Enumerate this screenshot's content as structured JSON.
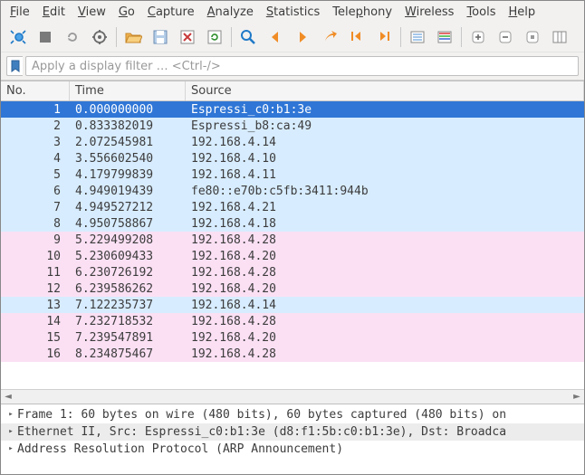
{
  "menu": {
    "items": [
      {
        "label": "File",
        "accel": 0
      },
      {
        "label": "Edit",
        "accel": 0
      },
      {
        "label": "View",
        "accel": 0
      },
      {
        "label": "Go",
        "accel": 0
      },
      {
        "label": "Capture",
        "accel": 0
      },
      {
        "label": "Analyze",
        "accel": 0
      },
      {
        "label": "Statistics",
        "accel": 0
      },
      {
        "label": "Telephony",
        "accel": 4
      },
      {
        "label": "Wireless",
        "accel": 0
      },
      {
        "label": "Tools",
        "accel": 0
      },
      {
        "label": "Help",
        "accel": 0
      }
    ]
  },
  "filter": {
    "placeholder": "Apply a display filter … <Ctrl-/>"
  },
  "columns": {
    "no": "No.",
    "time": "Time",
    "src": "Source"
  },
  "packets": [
    {
      "no": 1,
      "time": "0.000000000",
      "src": "Espressi_c0:b1:3e",
      "bg": "selected"
    },
    {
      "no": 2,
      "time": "0.833382019",
      "src": "Espressi_b8:ca:49",
      "bg": "blue"
    },
    {
      "no": 3,
      "time": "2.072545981",
      "src": "192.168.4.14",
      "bg": "blue"
    },
    {
      "no": 4,
      "time": "3.556602540",
      "src": "192.168.4.10",
      "bg": "blue"
    },
    {
      "no": 5,
      "time": "4.179799839",
      "src": "192.168.4.11",
      "bg": "blue"
    },
    {
      "no": 6,
      "time": "4.949019439",
      "src": "fe80::e70b:c5fb:3411:944b",
      "bg": "blue"
    },
    {
      "no": 7,
      "time": "4.949527212",
      "src": "192.168.4.21",
      "bg": "blue"
    },
    {
      "no": 8,
      "time": "4.950758867",
      "src": "192.168.4.18",
      "bg": "blue"
    },
    {
      "no": 9,
      "time": "5.229499208",
      "src": "192.168.4.28",
      "bg": "pink"
    },
    {
      "no": 10,
      "time": "5.230609433",
      "src": "192.168.4.20",
      "bg": "pink"
    },
    {
      "no": 11,
      "time": "6.230726192",
      "src": "192.168.4.28",
      "bg": "pink"
    },
    {
      "no": 12,
      "time": "6.239586262",
      "src": "192.168.4.20",
      "bg": "pink"
    },
    {
      "no": 13,
      "time": "7.122235737",
      "src": "192.168.4.14",
      "bg": "blue"
    },
    {
      "no": 14,
      "time": "7.232718532",
      "src": "192.168.4.28",
      "bg": "pink"
    },
    {
      "no": 15,
      "time": "7.239547891",
      "src": "192.168.4.20",
      "bg": "pink"
    },
    {
      "no": 16,
      "time": "8.234875467",
      "src": "192.168.4.28",
      "bg": "pink"
    }
  ],
  "details": [
    {
      "text": "Frame 1: 60 bytes on wire (480 bits), 60 bytes captured (480 bits) on",
      "sel": false
    },
    {
      "text": "Ethernet II, Src: Espressi_c0:b1:3e (d8:f1:5b:c0:b1:3e), Dst: Broadca",
      "sel": true
    },
    {
      "text": "Address Resolution Protocol (ARP Announcement)",
      "sel": false
    }
  ],
  "icons": {
    "start": "start-capture",
    "stop": "stop-capture",
    "restart": "restart-capture",
    "options": "capture-options",
    "open": "open-file",
    "save": "save-file",
    "close": "close-file",
    "reload": "reload-file",
    "find": "find-packet",
    "prev": "go-previous",
    "next": "go-next",
    "jump": "go-to-packet",
    "first": "go-first",
    "last": "go-last",
    "autoscroll": "auto-scroll",
    "colorize": "colorize",
    "zoomin": "zoom-in",
    "zoomout": "zoom-out",
    "zoomreset": "zoom-reset",
    "resize": "resize-columns"
  }
}
